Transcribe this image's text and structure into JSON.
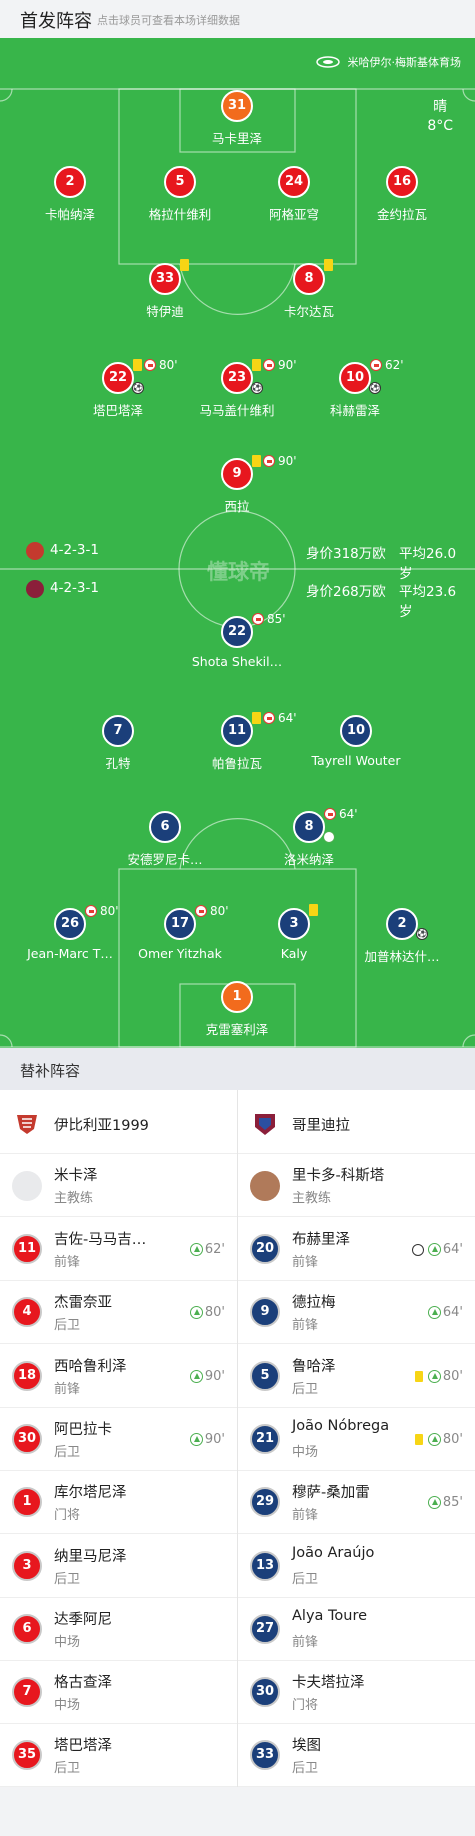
{
  "header": {
    "title": "首发阵容",
    "subtitle": "点击球员可查看本场详细数据"
  },
  "venue": "米哈伊尔·梅斯基体育场",
  "weather": {
    "condition": "晴",
    "temp": "8°C"
  },
  "watermark": "懂球帝",
  "home_info": {
    "formation": "4-2-3-1",
    "value": "身价318万欧",
    "age": "平均26.0岁"
  },
  "away_info": {
    "formation": "4-2-3-1",
    "value": "身价268万欧",
    "age": "平均23.6岁"
  },
  "home_players": [
    {
      "num": "31",
      "name": "马卡里泽",
      "gk": true
    },
    {
      "num": "2",
      "name": "卡帕纳泽"
    },
    {
      "num": "5",
      "name": "格拉什维利"
    },
    {
      "num": "24",
      "name": "阿格亚穹"
    },
    {
      "num": "16",
      "name": "金约拉瓦"
    },
    {
      "num": "33",
      "name": "特伊迪",
      "yellow": true
    },
    {
      "num": "8",
      "name": "卡尔达瓦",
      "yellow": true
    },
    {
      "num": "22",
      "name": "塔巴塔泽",
      "yellow": true,
      "subout": true,
      "minute": "80'",
      "goal": true
    },
    {
      "num": "23",
      "name": "马马盖什维利",
      "yellow": true,
      "subout": true,
      "minute": "90'",
      "goal": true
    },
    {
      "num": "10",
      "name": "科赫雷泽",
      "subout": true,
      "minute": "62'",
      "goal": true
    },
    {
      "num": "9",
      "name": "西拉",
      "yellow": true,
      "subout": true,
      "minute": "90'"
    }
  ],
  "away_players": [
    {
      "num": "22",
      "name": "Shota Shekil…",
      "subout": true,
      "minute": "85'"
    },
    {
      "num": "7",
      "name": "孔特"
    },
    {
      "num": "11",
      "name": "帕鲁拉瓦",
      "yellow": true,
      "subout": true,
      "minute": "64'"
    },
    {
      "num": "10",
      "name": "Tayrell Wouter"
    },
    {
      "num": "6",
      "name": "安德罗尼卡…"
    },
    {
      "num": "8",
      "name": "洛米纳泽",
      "subout": true,
      "minute": "64'",
      "subin_mark": true
    },
    {
      "num": "26",
      "name": "Jean-Marc T…",
      "subout": true,
      "minute": "80'"
    },
    {
      "num": "17",
      "name": "Omer Yitzhak",
      "subout": true,
      "minute": "80'"
    },
    {
      "num": "3",
      "name": "Kaly",
      "yellow": true
    },
    {
      "num": "2",
      "name": "加普林达什…",
      "goal": true
    },
    {
      "num": "1",
      "name": "克雷塞利泽",
      "gk": true
    }
  ],
  "subs_section": {
    "title": "替补阵容"
  },
  "home_team": {
    "name": "伊比利亚1999",
    "coach": {
      "name": "米卡泽",
      "role": "主教练"
    }
  },
  "away_team": {
    "name": "哥里迪拉",
    "coach": {
      "name": "里卡多-科斯塔",
      "role": "主教练"
    }
  },
  "home_subs": [
    {
      "num": "11",
      "name": "吉佐-马马吉…",
      "pos": "前锋",
      "minute": "62'",
      "up": true
    },
    {
      "num": "4",
      "name": "杰雷奈亚",
      "pos": "后卫",
      "minute": "80'",
      "up": true
    },
    {
      "num": "18",
      "name": "西哈鲁利泽",
      "pos": "前锋",
      "minute": "90'",
      "up": true
    },
    {
      "num": "30",
      "name": "阿巴拉卡",
      "pos": "后卫",
      "minute": "90'",
      "up": true
    },
    {
      "num": "1",
      "name": "库尔塔尼泽",
      "pos": "门将"
    },
    {
      "num": "3",
      "name": "纳里马尼泽",
      "pos": "后卫"
    },
    {
      "num": "6",
      "name": "达季阿尼",
      "pos": "中场"
    },
    {
      "num": "7",
      "name": "格古查泽",
      "pos": "中场"
    },
    {
      "num": "35",
      "name": "塔巴塔泽",
      "pos": "后卫"
    }
  ],
  "away_subs": [
    {
      "num": "20",
      "name": "布赫里泽",
      "pos": "前锋",
      "minute": "64'",
      "up": true,
      "ball": true
    },
    {
      "num": "9",
      "name": "德拉梅",
      "pos": "前锋",
      "minute": "64'",
      "up": true
    },
    {
      "num": "5",
      "name": "鲁哈泽",
      "pos": "后卫",
      "minute": "80'",
      "up": true,
      "yellow": true
    },
    {
      "num": "21",
      "name": "João Nóbrega",
      "pos": "中场",
      "minute": "80'",
      "up": true,
      "yellow": true
    },
    {
      "num": "29",
      "name": "穆萨-桑加雷",
      "pos": "前锋",
      "minute": "85'",
      "up": true
    },
    {
      "num": "13",
      "name": "João Araújo",
      "pos": "后卫"
    },
    {
      "num": "27",
      "name": "Alya Toure",
      "pos": "前锋"
    },
    {
      "num": "30",
      "name": "卡夫塔拉泽",
      "pos": "门将"
    },
    {
      "num": "33",
      "name": "埃图",
      "pos": "后卫"
    }
  ],
  "colors": {
    "pitch": "#38b54a",
    "home": "#e7171e",
    "away": "#1b3f7a",
    "gk": "#f26b1d"
  }
}
